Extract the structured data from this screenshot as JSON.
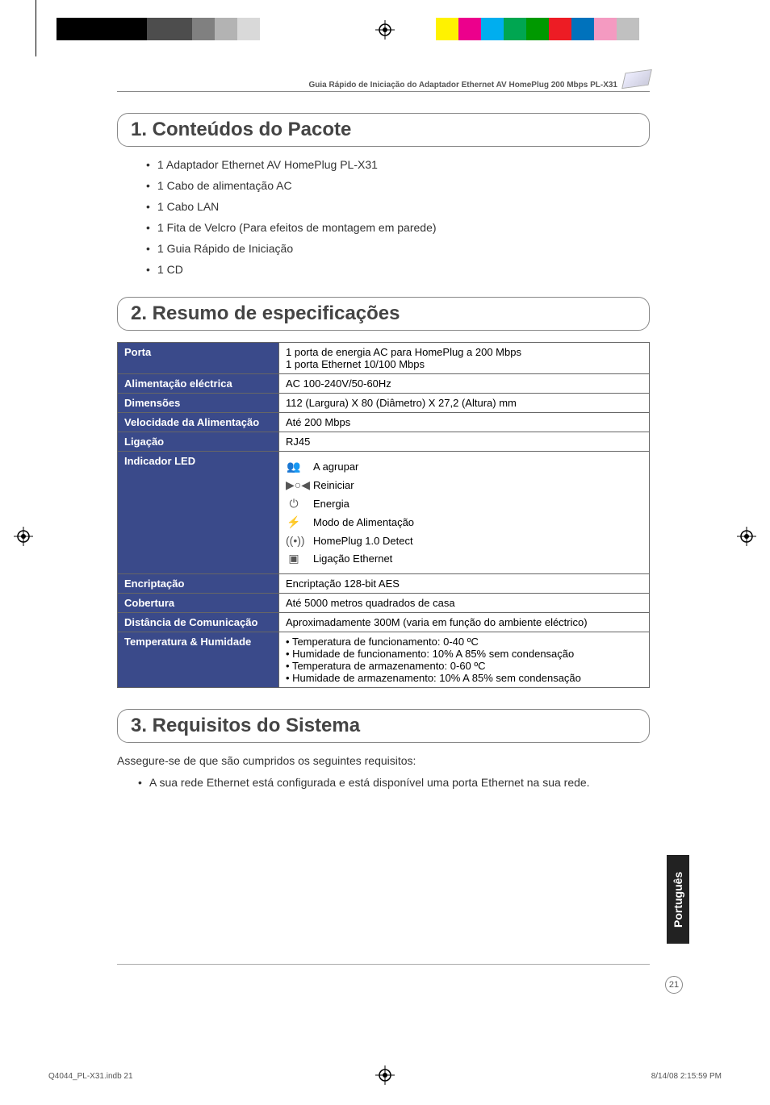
{
  "doc_header": "Guia Rápido de Iniciação do Adaptador Ethernet AV HomePlug 200 Mbps PL-X31",
  "sections": {
    "s1": {
      "title": "1. Conteúdos do Pacote"
    },
    "s2": {
      "title": "2. Resumo de especificações"
    },
    "s3": {
      "title": "3. Requisitos do Sistema"
    }
  },
  "package_contents": [
    "1 Adaptador Ethernet AV HomePlug PL-X31",
    "1 Cabo de alimentação AC",
    "1 Cabo LAN",
    "1 Fita de Velcro (Para efeitos de montagem em parede)",
    "1 Guia Rápido de Iniciação",
    "1 CD"
  ],
  "spec_labels": {
    "port": "Porta",
    "power": "Alimentação eléctrica",
    "dim": "Dimensões",
    "speed": "Velocidade da Alimentação",
    "conn": "Ligação",
    "led": "Indicador LED",
    "enc": "Encriptação",
    "cov": "Cobertura",
    "dist": "Distância de Comunicação",
    "temp": "Temperatura & Humidade"
  },
  "spec_values": {
    "port_l1": "1 porta de energia AC para HomePlug a 200 Mbps",
    "port_l2": "1 porta Ethernet 10/100 Mbps",
    "power": "AC 100-240V/50-60Hz",
    "dim": "112 (Largura) X 80 (Diâmetro) X 27,2 (Altura) mm",
    "speed": "Até 200 Mbps",
    "conn": "RJ45",
    "led": {
      "group": "A agrupar",
      "reset": "Reiniciar",
      "power": "Energia",
      "mode": "Modo de Alimentação",
      "detect": "HomePlug 1.0 Detect",
      "eth": "Ligação Ethernet"
    },
    "enc": "Encriptação 128-bit AES",
    "cov": "Até 5000 metros quadrados de casa",
    "dist": "Aproximadamente 300M (varia em função do ambiente eléctrico)",
    "temp": [
      "Temperatura de funcionamento: 0-40 ºC",
      "Humidade de funcionamento: 10% A 85% sem condensação",
      "Temperatura de armazenamento: 0-60 ºC",
      "Humidade de armazenamento: 10% A 85% sem condensação"
    ]
  },
  "system_req_intro": "Assegure-se de que são cumpridos os seguintes requisitos:",
  "system_req_items": [
    "A sua rede Ethernet está configurada e está disponível uma porta Ethernet na sua rede."
  ],
  "language_tab": "Português",
  "page_number": "21",
  "footer": {
    "left": "Q4044_PL-X31.indb   21",
    "right": "8/14/08   2:15:59 PM"
  },
  "printer_bars": {
    "left": [
      "#000000",
      "#000000",
      "#4d4d4d",
      "#4d4d4d",
      "#808080",
      "#b3b3b3",
      "#d9d9d9"
    ],
    "right": [
      "#ffff00",
      "#ff00ff",
      "#00ffff",
      "#00a651",
      "#009900",
      "#ed1c24",
      "#0072bc",
      "#ff9ecf",
      "#c0c0c0"
    ]
  }
}
